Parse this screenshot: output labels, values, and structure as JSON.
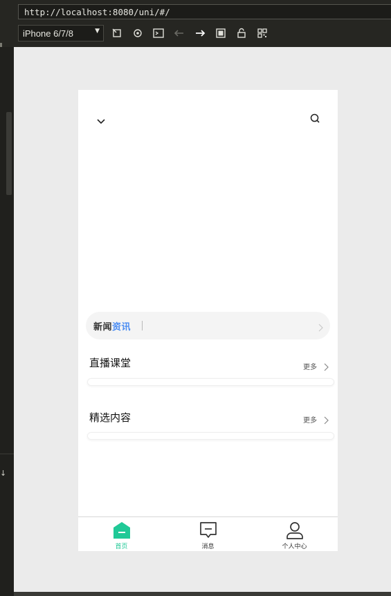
{
  "ide": {
    "url": "http://localhost:8080/uni/#/",
    "device": "iPhone 6/7/8",
    "toolbar_icons": [
      "rotate-icon",
      "settings-icon",
      "console-icon",
      "back-arrow-icon",
      "forward-arrow-icon",
      "screenshot-icon",
      "lock-icon",
      "qrcode-icon"
    ]
  },
  "app": {
    "header": {
      "left_icon": "chevron-down-icon",
      "right_icon": "search-icon"
    },
    "news": {
      "title_part1": "新闻",
      "title_part2": "资讯",
      "accent": "#4a8cf3"
    },
    "sections": [
      {
        "title": "直播课堂",
        "more": "更多"
      },
      {
        "title": "精选内容",
        "more": "更多"
      }
    ],
    "tabbar": {
      "active_color": "#20c997",
      "items": [
        {
          "label": "首页",
          "icon": "home-icon",
          "active": true
        },
        {
          "label": "消息",
          "icon": "message-icon",
          "active": false
        },
        {
          "label": "个人中心",
          "icon": "user-icon",
          "active": false
        }
      ]
    }
  }
}
